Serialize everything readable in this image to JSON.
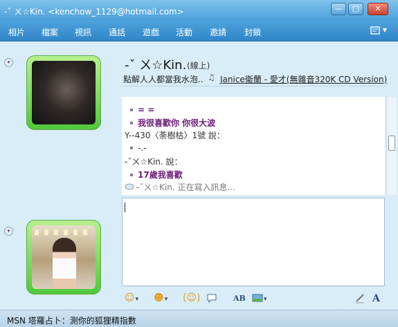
{
  "window": {
    "title": "-ˇ ㄨ☆Kin. <kenchow_1129@hotmail.com>",
    "buttons": {
      "minimize": "—",
      "maximize": "□",
      "close": "✕"
    }
  },
  "menu": {
    "items": [
      "相片",
      "檔案",
      "視訊",
      "通話",
      "遊戲",
      "活動",
      "邀請",
      "封鎖"
    ],
    "more": "▾"
  },
  "contact": {
    "name": "-ˇ ㄨ☆Kin.",
    "status": "(線上)",
    "personal_message": "點解人人都當我水泡..",
    "music_text": "Janice衛蘭 - 愛才(無雜音320K CD Version)"
  },
  "conversation": {
    "lines": [
      {
        "type": "msg",
        "text": "= ="
      },
      {
        "type": "msg",
        "text": "我很喜歡你 你很大波"
      },
      {
        "type": "sender",
        "text": "Y--430〈荼樹枯〉1號 說："
      },
      {
        "type": "plain",
        "text": "-.-"
      },
      {
        "type": "sender",
        "text": "-ˇㄨ☆Kin. 說："
      },
      {
        "type": "msg",
        "text": "17歲我喜歡"
      }
    ],
    "typing": "-ˇㄨ☆Kin. 正在寫入訊息..."
  },
  "status_bar": {
    "text": "MSN 塔羅占卜：測你的狐狸精指數"
  },
  "colors": {
    "accent": "#2f86c7",
    "avatar_frame": "#4fc83a",
    "message": "#6a1b7a"
  }
}
